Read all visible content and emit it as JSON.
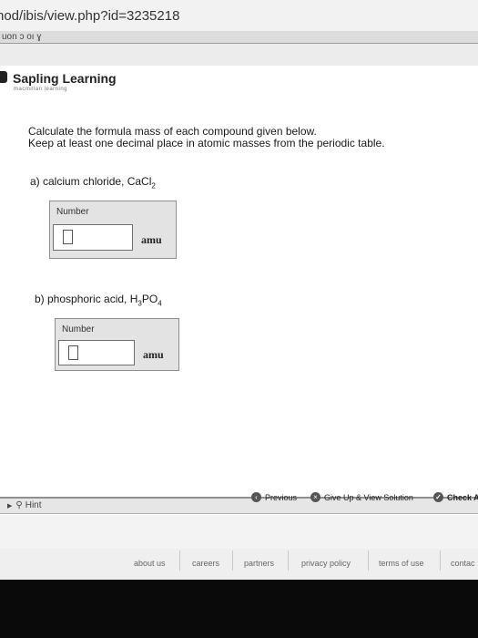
{
  "browser": {
    "url_fragment": "nod/ibis/view.php?id=3235218",
    "tab_fragment": "uon ɔ oı ɣ"
  },
  "brand": {
    "name": "Sapling Learning",
    "tagline": "macmillan learning"
  },
  "question": {
    "instruction_line1": "Calculate the formula mass of each compound given below.",
    "instruction_line2": "Keep at least one decimal place in atomic masses from the periodic table.",
    "parts": [
      {
        "prompt": "a) calcium chloride, CaCl",
        "formula_sub": "2",
        "field_label": "Number",
        "value": "",
        "unit": "amu"
      },
      {
        "prompt": "b) phosphoric acid, H",
        "formula_mid": "3",
        "formula_tail": "PO",
        "formula_sub": "4",
        "field_label": "Number",
        "value": "",
        "unit": "amu"
      }
    ]
  },
  "actions": {
    "hint": "Hint",
    "previous": "Previous",
    "give_up": "Give Up & View Solution",
    "check": "Check A"
  },
  "footer": {
    "links": [
      "about us",
      "careers",
      "partners",
      "privacy policy",
      "terms of use",
      "contac"
    ]
  }
}
